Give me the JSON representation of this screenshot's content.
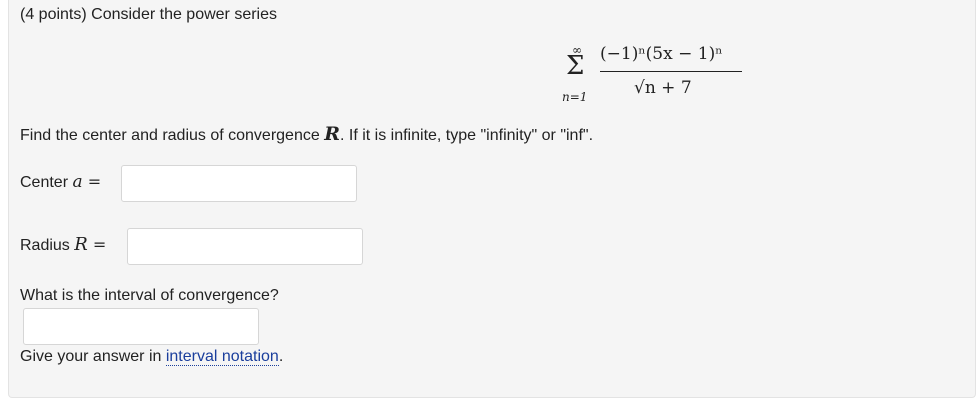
{
  "problem": {
    "intro": "(4 points) Consider the power series",
    "series": {
      "upper_limit": "∞",
      "sigma": "Σ",
      "lower_limit": "n=1",
      "numerator": "(−1)ⁿ(5x − 1)ⁿ",
      "denominator": "√n + 7"
    },
    "question_before": "Find the center and radius of convergence ",
    "question_var": "R",
    "question_after": ". If it is infinite, type \"infinity\" or \"inf\".",
    "center_label": "Center ",
    "center_var": "a",
    "center_eq": " =",
    "center_value": "",
    "radius_label": "Radius ",
    "radius_var": "R",
    "radius_eq": " =",
    "radius_value": "",
    "interval_question": "What is the interval of convergence?",
    "interval_value": "",
    "hint_before": "Give your answer in ",
    "hint_link": "interval notation",
    "hint_after": "."
  }
}
